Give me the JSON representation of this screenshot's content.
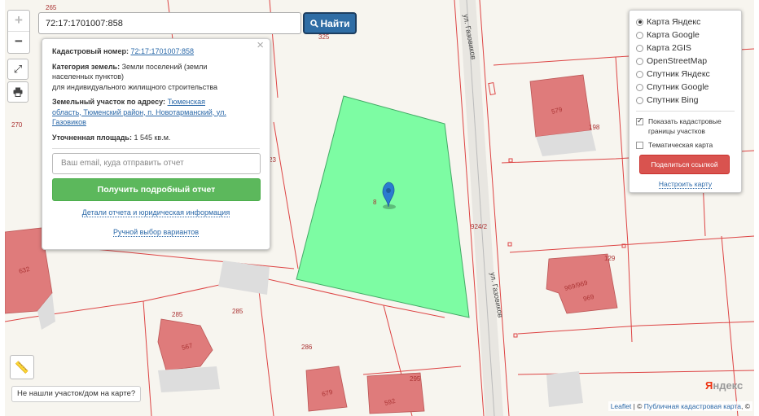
{
  "search": {
    "value": "72:17:1701007:858",
    "button_label": "Найти"
  },
  "zoom": {
    "in": "+",
    "out": "−"
  },
  "info_panel": {
    "cadastral_label": "Кадастровый номер:",
    "cadastral_value": "72:17:1701007:858",
    "category_label": "Категория земель:",
    "category_value_1": "Земли поселений (земли",
    "category_value_2": "населенных пунктов)",
    "category_value_3": "для индивидуального жилищного строительства",
    "address_label": "Земельный участок по адресу:",
    "address_value_1": "Тюменская",
    "address_value_2": "область, Тюменский район, п. Новотарманский, ул.",
    "address_value_3": "Газовиков",
    "area_label": "Уточненная площадь:",
    "area_value": "1 545 кв.м.",
    "email_placeholder": "Ваш email, куда отправить отчет",
    "report_button": "Получить подробный отчет",
    "details_link": "Детали отчета и юридическая информация",
    "manual_link": "Ручной выбор вариантов"
  },
  "layers_panel": {
    "options": [
      {
        "label": "Карта Яндекс",
        "selected": true
      },
      {
        "label": "Карта Google",
        "selected": false
      },
      {
        "label": "Карта 2GIS",
        "selected": false
      },
      {
        "label": "OpenStreetMap",
        "selected": false
      },
      {
        "label": "Спутник Яндекс",
        "selected": false
      },
      {
        "label": "Спутник Google",
        "selected": false
      },
      {
        "label": "Спутник Bing",
        "selected": false
      }
    ],
    "show_borders_1": "Показать кадастровые",
    "show_borders_2": "границы участков",
    "thematic": "Тематическая карта",
    "share_button": "Поделиться ссылкой",
    "configure_link": "Настроить карту"
  },
  "map": {
    "street_name": "ул. Газовиков",
    "parcel_numbers": [
      "265",
      "325",
      "270",
      "23",
      "924/2",
      "285",
      "285",
      "286",
      "295",
      "198",
      "129"
    ],
    "building_numbers": [
      "579",
      "632",
      "567",
      "679",
      "592",
      "969/969",
      "969"
    ],
    "selected_parcel_label": "8",
    "colors": {
      "selected_parcel": "#7dfca3",
      "building": "#df7b7b",
      "parcel_line": "#d44",
      "background": "#f7f5ef"
    }
  },
  "bottom": {
    "not_found": "Не нашли участок/дом на карте?",
    "attr_leaflet": "Leaflet",
    "attr_sep": " | © ",
    "attr_pkk": "Публичная кадастровая карта",
    "attr_tail": ", ©",
    "yandex_logo_1": "Я",
    "yandex_logo_2": "ндекс"
  }
}
